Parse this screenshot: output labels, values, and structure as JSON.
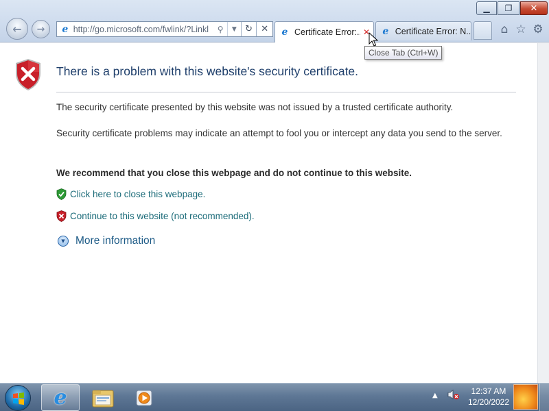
{
  "window": {
    "minimize_glyph": "▁",
    "maximize_glyph": "❐",
    "close_glyph": "✕"
  },
  "toolbar": {
    "back_glyph": "←",
    "forward_glyph": "→",
    "address": "http://go.microsoft.com/fwlink/?Linkl",
    "search_glyph": "⚲",
    "dropdown_glyph": "▼",
    "refresh_glyph": "↻",
    "stop_glyph": "✕",
    "home_glyph": "⌂",
    "favorites_glyph": "☆",
    "tools_glyph": "⚙"
  },
  "tabs": [
    {
      "label": "Certificate Error:...",
      "active": true,
      "close_glyph": "✕"
    },
    {
      "label": "Certificate Error: N...",
      "active": false
    }
  ],
  "tooltip": "Close Tab (Ctrl+W)",
  "page": {
    "headline": "There is a problem with this website's security certificate.",
    "paragraph1": "The security certificate presented by this website was not issued by a trusted certificate authority.",
    "paragraph2": "Security certificate problems may indicate an attempt to fool you or intercept any data you send to the server.",
    "recommendation": "We recommend that you close this webpage and do not continue to this website.",
    "close_link": "Click here to close this webpage.",
    "continue_link": "Continue to this website (not recommended).",
    "more_info": "More information"
  },
  "taskbar": {
    "time": "12:37 AM",
    "date": "12/20/2022",
    "tray_arrow_glyph": "▲"
  },
  "colors": {
    "headline": "#1f3f6b",
    "link": "#1a6a78",
    "shield_red": "#c8202a",
    "shield_green": "#2e9a36"
  }
}
